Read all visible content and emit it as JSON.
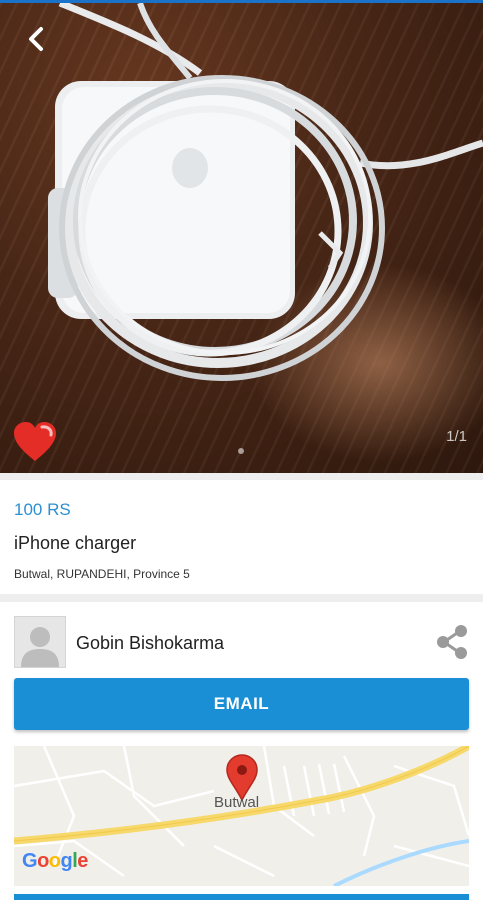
{
  "listing": {
    "price": "100 RS",
    "title": "iPhone charger",
    "location": "Butwal, RUPANDEHI, Province 5",
    "image_counter": "1/1",
    "favorited": true
  },
  "seller": {
    "name": "Gobin Bishokarma"
  },
  "actions": {
    "email_label": "EMAIL"
  },
  "map": {
    "place_label": "Butwal",
    "provider": "Google"
  },
  "icons": {
    "back": "back-arrow-icon",
    "favorite": "heart-icon",
    "share": "share-icon",
    "avatar": "user-placeholder-icon",
    "pin": "map-pin-icon"
  },
  "colors": {
    "accent": "#1a8fd6",
    "price": "#2c8fd1",
    "heart": "#e52d27",
    "pin": "#e33b2e"
  }
}
